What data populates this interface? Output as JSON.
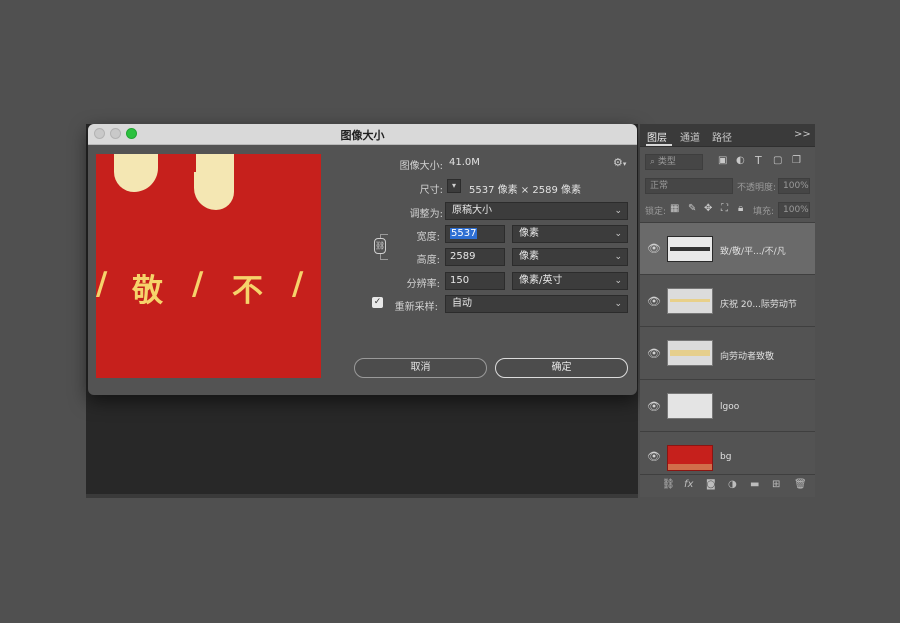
{
  "dialog": {
    "title": "图像大小",
    "image_size_label": "图像大小:",
    "image_size_value": "41.0M",
    "gear_icon": "gear-icon",
    "dimensions_label": "尺寸:",
    "dimensions_value": "5537 像素 × 2589 像素",
    "fit_label": "调整为:",
    "fit_value": "原稿大小",
    "width_label": "宽度:",
    "width_value": "5537",
    "width_unit": "像素",
    "height_label": "高度:",
    "height_value": "2589",
    "height_unit": "像素",
    "resolution_label": "分辨率:",
    "resolution_value": "150",
    "resolution_unit": "像素/英寸",
    "resample_label": "重新采样:",
    "resample_checked": true,
    "resample_value": "自动",
    "cancel_label": "取消",
    "ok_label": "确定",
    "preview_text": [
      "/",
      "敬",
      "/",
      "不",
      "/"
    ]
  },
  "panel": {
    "tabs": [
      "图层",
      "通道",
      "路径"
    ],
    "tabs_more": ">>",
    "filter_label": "类型",
    "blend_mode": "正常",
    "opacity_label": "不透明度:",
    "opacity_value": "100%",
    "lock_label": "锁定:",
    "fill_label": "填充:",
    "fill_value": "100%",
    "layers": [
      {
        "name": "致/敬/平.../不/凡",
        "selected": true
      },
      {
        "name": "庆祝 20...际劳动节",
        "selected": false
      },
      {
        "name": "向劳动者致敬",
        "selected": false
      },
      {
        "name": "lgoo",
        "selected": false
      },
      {
        "name": "bg",
        "selected": false
      }
    ]
  },
  "colors": {
    "accent": "#2e6fd3",
    "preview_red": "#c6201c",
    "preview_text": "#f6d36b",
    "zoom_button": "#2cc13f"
  }
}
